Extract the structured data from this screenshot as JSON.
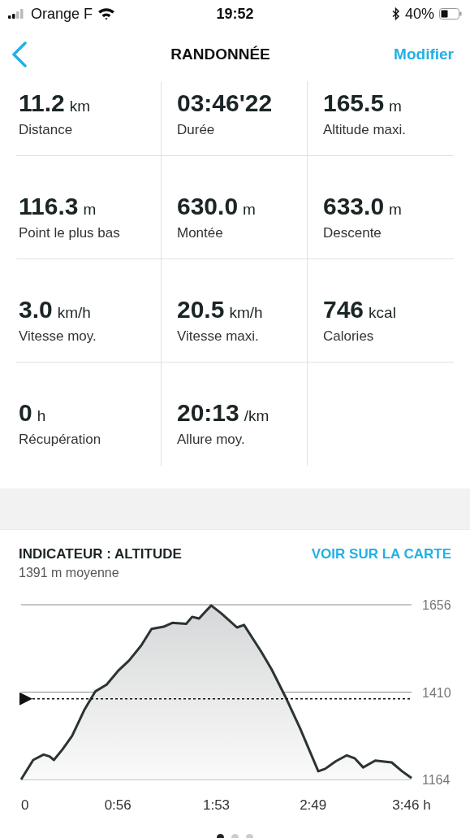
{
  "status_bar": {
    "carrier": "Orange F",
    "time": "19:52",
    "battery": "40%"
  },
  "nav": {
    "title": "RANDONNÉE",
    "action": "Modifier"
  },
  "stats": [
    {
      "value": "11.2",
      "unit": "km",
      "label": "Distance"
    },
    {
      "value": "03:46'22",
      "label": "Durée"
    },
    {
      "value": "165.5",
      "unit": "m",
      "label": "Altitude maxi."
    },
    {
      "value": "116.3",
      "unit": "m",
      "label": "Point le plus bas"
    },
    {
      "value": "630.0",
      "unit": "m",
      "label": "Montée"
    },
    {
      "value": "633.0",
      "unit": "m",
      "label": "Descente"
    },
    {
      "value": "3.0",
      "unit": "km/h",
      "label": "Vitesse moy."
    },
    {
      "value": "20.5",
      "unit": "km/h",
      "label": "Vitesse maxi."
    },
    {
      "value": "746",
      "unit": "kcal",
      "label": "Calories"
    },
    {
      "value": "0",
      "unit": "h",
      "label": "Récupération"
    },
    {
      "value": "20:13",
      "unit": "/km",
      "label": "Allure moy."
    }
  ],
  "chart_section": {
    "title": "INDICATEUR : ALTITUDE",
    "link": "VOIR SUR LA CARTE",
    "subtitle": "1391 m moyenne",
    "chart_data": {
      "type": "area",
      "x": [
        0,
        7,
        13,
        16.5,
        19,
        24,
        29.5,
        36.5,
        43,
        49.5,
        56,
        62.5,
        69.5,
        75.5,
        82.5,
        87.5,
        95.5,
        99,
        103,
        110,
        116,
        125,
        129,
        139,
        145,
        153,
        161.5,
        172,
        176,
        182,
        188.5,
        193,
        198,
        205,
        214.5,
        220.5,
        226
      ],
      "series": [
        {
          "color": "#2b3335",
          "values": [
            1164,
            1219,
            1234,
            1229,
            1219,
            1249,
            1287,
            1359,
            1412,
            1431,
            1469,
            1499,
            1541,
            1588,
            1594,
            1605,
            1602,
            1622,
            1617,
            1654,
            1631,
            1592,
            1599,
            1524,
            1474,
            1397,
            1308,
            1187,
            1194,
            1215,
            1232,
            1224,
            1198,
            1217,
            1212,
            1187,
            1168
          ]
        }
      ],
      "xlim": [
        0,
        226
      ],
      "ylim": [
        1164,
        1656
      ],
      "xticks": [
        {
          "value": 0,
          "label": "0"
        },
        {
          "value": 56,
          "label": "0:56"
        },
        {
          "value": 113,
          "label": "1:53"
        },
        {
          "value": 169,
          "label": "2:49"
        },
        {
          "value": 226,
          "label": "3:46 h"
        }
      ],
      "yticks": [
        1164,
        1410,
        1656
      ],
      "ref_lines": [
        {
          "axis": "y",
          "value": 1391
        }
      ]
    }
  },
  "pager": [
    {
      "selected": true
    },
    {
      "selected": false
    },
    {
      "selected": false
    }
  ]
}
